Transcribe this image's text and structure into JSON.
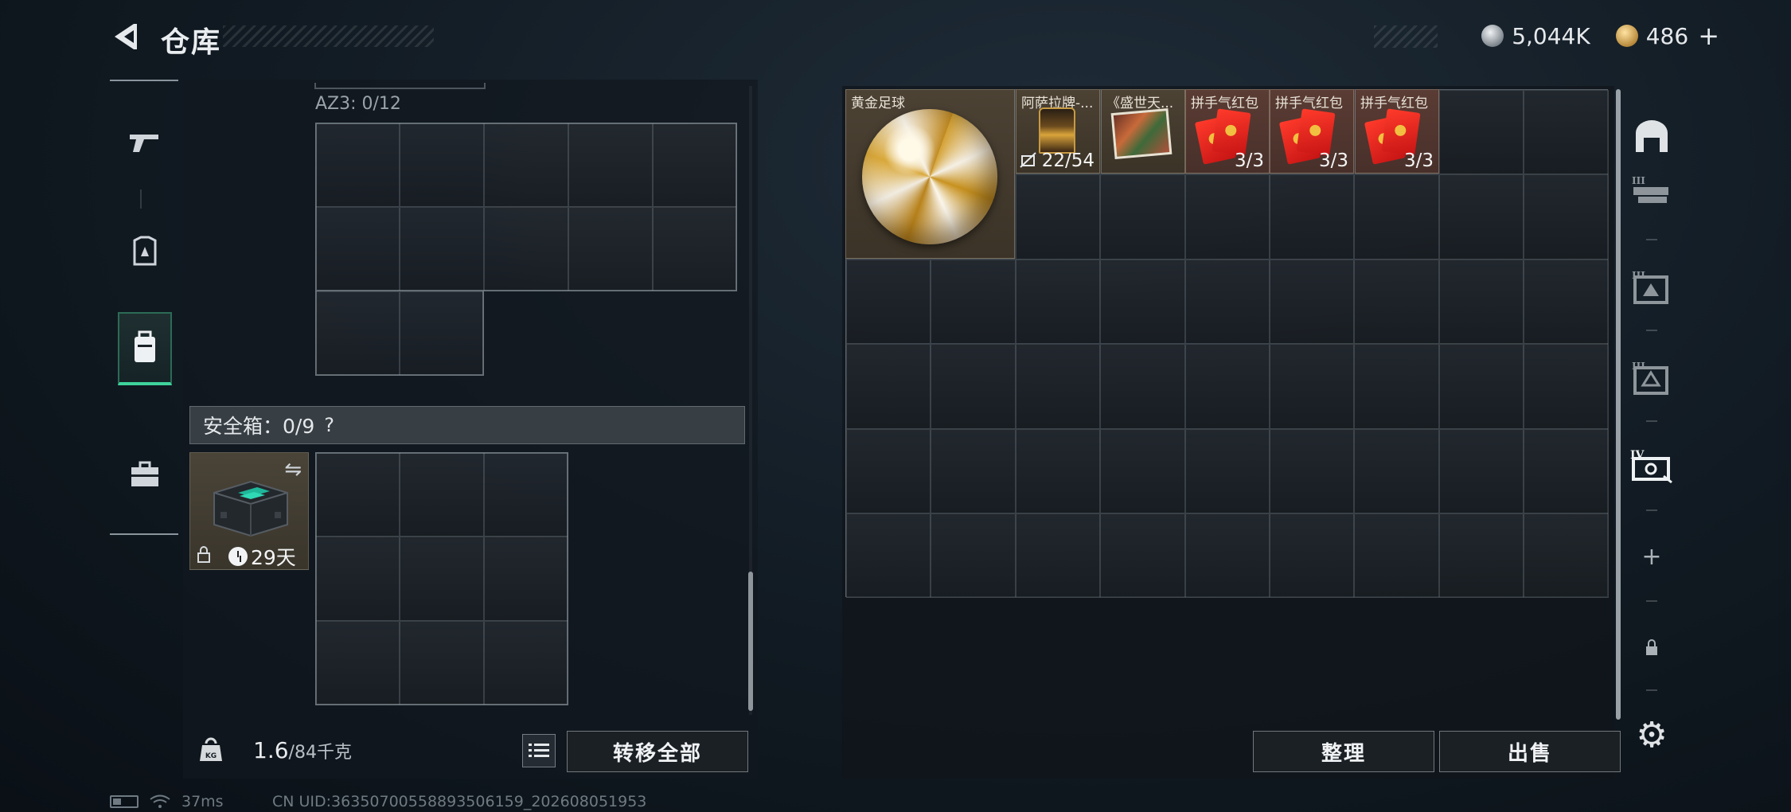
{
  "header": {
    "title": "仓库",
    "silver_amount": "5,044K",
    "gold_amount": "486",
    "add_label": "+"
  },
  "left_rail": {
    "items": [
      {
        "icon": "gun-icon"
      },
      {
        "icon": "armor-icon"
      },
      {
        "icon": "backpack-icon",
        "active": true
      },
      {
        "icon": "toolbox-icon"
      }
    ]
  },
  "inventory": {
    "az3_label": "AZ3: 0/12",
    "safe_box_label": "安全箱：0/9",
    "help_label": "?",
    "safe_item": {
      "duration": "29天",
      "locked": true
    },
    "weight_current": "1.6",
    "weight_max": "/84千克",
    "transfer_all_label": "转移全部"
  },
  "stash": {
    "items": [
      {
        "name": "黄金足球",
        "count": ""
      },
      {
        "name": "阿萨拉牌-...",
        "count": "22/54"
      },
      {
        "name": "《盛世天...",
        "count": ""
      },
      {
        "name": "拼手气红包",
        "count": "3/3"
      },
      {
        "name": "拼手气红包",
        "count": "3/3"
      },
      {
        "name": "拼手气红包",
        "count": "3/3"
      }
    ],
    "sort_label": "整理",
    "sell_label": "出售"
  },
  "right_rail": {
    "items": [
      {
        "icon": "storage-home-icon"
      },
      {
        "icon": "stash-tier-3a-icon",
        "label": "III"
      },
      {
        "icon": "stash-tier-3b-icon",
        "label": "III"
      },
      {
        "icon": "stash-tier-3c-icon",
        "label": "III"
      },
      {
        "icon": "stash-tier-4-icon",
        "label": "IV"
      },
      {
        "icon": "add-page-icon",
        "label": "+"
      },
      {
        "icon": "locked-page-icon"
      },
      {
        "icon": "settings-icon"
      }
    ]
  },
  "status_bar": {
    "ping": "37ms",
    "uid": "CN UID:363507005588935061​59_202608051953"
  },
  "colors": {
    "accent_green": "#3ed29b",
    "item_gold_bg": "#4c4234",
    "envelope_red": "#e02a1e"
  }
}
